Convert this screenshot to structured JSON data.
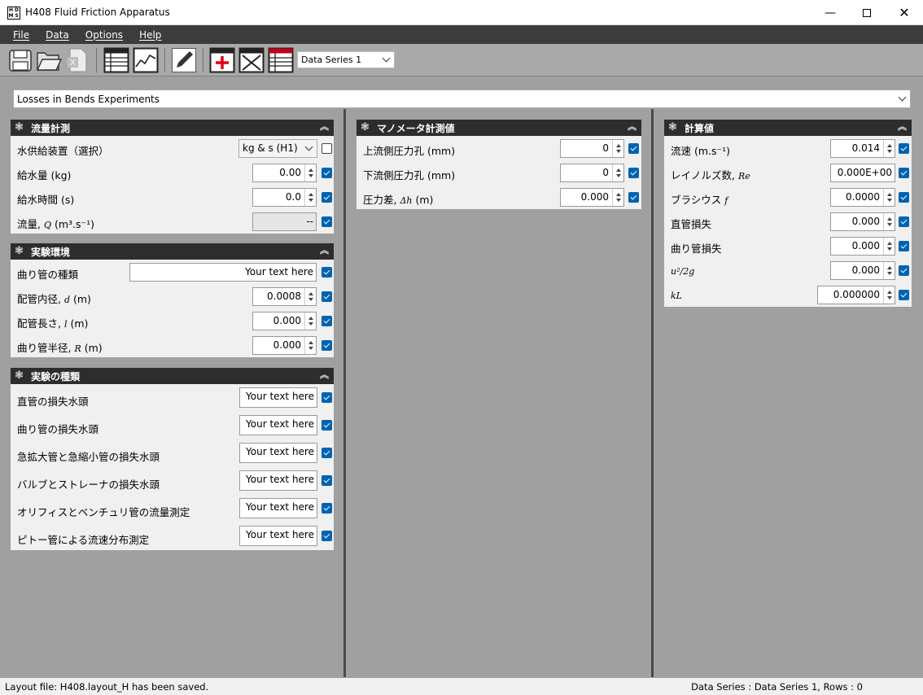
{
  "window": {
    "title": "H408 Fluid Friction Apparatus",
    "logo": "HDMS"
  },
  "menu": [
    "File",
    "Data",
    "Options",
    "Help"
  ],
  "toolbar": {
    "series_selected": "Data Series 1"
  },
  "experiment": {
    "selected": "Losses in Bends Experiments"
  },
  "flow": {
    "title": "流量計測",
    "rows": [
      {
        "label": "水供給装置（選択）",
        "value": "kg & s (H1)"
      },
      {
        "label": "給水量 (kg)",
        "value": "0.00"
      },
      {
        "label": "給水時間 (s)",
        "value": "0.0"
      },
      {
        "label_a": "流量, ",
        "label_sym": "Q",
        "label_b": " (m³.s⁻¹)",
        "value": "--"
      }
    ]
  },
  "env": {
    "title": "実験環境",
    "rows": [
      {
        "label": "曲り管の種類",
        "value": "Your text here"
      },
      {
        "label_a": "配管内径, ",
        "label_sym": "d",
        "label_b": " (m)",
        "value": "0.0008"
      },
      {
        "label_a": "配管長さ, ",
        "label_sym": "l",
        "label_b": " (m)",
        "value": "0.000"
      },
      {
        "label_a": "曲り管半径, ",
        "label_sym": "R",
        "label_b": " (m)",
        "value": "0.000"
      }
    ]
  },
  "types": {
    "title": "実験の種類",
    "rows": [
      {
        "label": "直管の損失水頭",
        "value": "Your text here"
      },
      {
        "label": "曲り管の損失水頭",
        "value": "Your text here"
      },
      {
        "label": "急拡大管と急縮小管の損失水頭",
        "value": "Your text here"
      },
      {
        "label": "バルブとストレーナの損失水頭",
        "value": "Your text here"
      },
      {
        "label": "オリフィスとベンチュリ管の流量測定",
        "value": "Your text here"
      },
      {
        "label": "ピトー管による流速分布測定",
        "value": "Your text here"
      }
    ]
  },
  "manometer": {
    "title": "マノメータ計測値",
    "rows": [
      {
        "label": "上流側圧力孔 (mm)",
        "value": "0"
      },
      {
        "label": "下流側圧力孔 (mm)",
        "value": "0"
      },
      {
        "label_a": "圧力差, ",
        "label_sym": "Δh",
        "label_b": " (m)",
        "value": "0.000"
      }
    ]
  },
  "calc": {
    "title": "計算値",
    "rows": [
      {
        "label": "流速 (m.s⁻¹)",
        "value": "0.014"
      },
      {
        "label_a": "レイノルズ数, ",
        "label_sym": "Re",
        "value": "0.000E+00"
      },
      {
        "label_a": "ブラシウス ",
        "label_sym": "f",
        "value": "0.0000"
      },
      {
        "label": "直管損失",
        "value": "0.000"
      },
      {
        "label": "曲り管損失",
        "value": "0.000"
      },
      {
        "label_sym": "u²/2g",
        "value": "0.000"
      },
      {
        "label_sym": "kL",
        "value": "0.000000"
      }
    ]
  },
  "status": {
    "left": "Layout file: H408.layout_H has been saved.",
    "right": "Data Series : Data Series 1,  Rows : 0"
  }
}
